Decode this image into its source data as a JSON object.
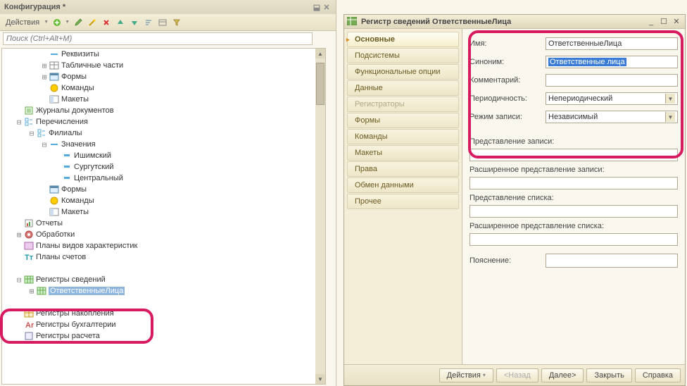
{
  "leftPanel": {
    "title": "Конфигурация *",
    "actionsLabel": "Действия",
    "searchPlaceholder": "Поиск (Ctrl+Alt+M)"
  },
  "tree": {
    "items": [
      {
        "indent": 3,
        "expand": "",
        "icon": "dash",
        "label": "Реквизиты"
      },
      {
        "indent": 3,
        "expand": "+",
        "icon": "table",
        "label": "Табличные части"
      },
      {
        "indent": 3,
        "expand": "+",
        "icon": "form",
        "label": "Формы"
      },
      {
        "indent": 3,
        "expand": "",
        "icon": "cmd",
        "label": "Команды"
      },
      {
        "indent": 3,
        "expand": "",
        "icon": "layout",
        "label": "Макеты"
      },
      {
        "indent": 1,
        "expand": "",
        "icon": "journal",
        "label": "Журналы документов"
      },
      {
        "indent": 1,
        "expand": "-",
        "icon": "enum",
        "label": "Перечисления"
      },
      {
        "indent": 2,
        "expand": "-",
        "icon": "enum",
        "label": "Филиалы"
      },
      {
        "indent": 3,
        "expand": "-",
        "icon": "dash",
        "label": "Значения"
      },
      {
        "indent": 4,
        "expand": "",
        "icon": "val",
        "label": "Ишимский"
      },
      {
        "indent": 4,
        "expand": "",
        "icon": "val",
        "label": "Сургутский"
      },
      {
        "indent": 4,
        "expand": "",
        "icon": "val",
        "label": "Центральный"
      },
      {
        "indent": 3,
        "expand": "",
        "icon": "form",
        "label": "Формы"
      },
      {
        "indent": 3,
        "expand": "",
        "icon": "cmd",
        "label": "Команды"
      },
      {
        "indent": 3,
        "expand": "",
        "icon": "layout",
        "label": "Макеты"
      },
      {
        "indent": 1,
        "expand": "",
        "icon": "report",
        "label": "Отчеты"
      },
      {
        "indent": 1,
        "expand": "+",
        "icon": "proc",
        "label": "Обработки"
      },
      {
        "indent": 1,
        "expand": "",
        "icon": "pvh",
        "label": "Планы видов характеристик"
      },
      {
        "indent": 1,
        "expand": "",
        "icon": "acct",
        "label": "Планы счетов"
      },
      {
        "indent": 1,
        "expand": "",
        "icon": "blank",
        "label": ""
      },
      {
        "indent": 1,
        "expand": "-",
        "icon": "info-reg",
        "label": "Регистры сведений"
      },
      {
        "indent": 2,
        "expand": "+",
        "icon": "info-reg",
        "label": "ОтветственныеЛица",
        "selected": true
      },
      {
        "indent": 1,
        "expand": "",
        "icon": "blank",
        "label": ""
      },
      {
        "indent": 1,
        "expand": "",
        "icon": "accum",
        "label": "Регистры накопления"
      },
      {
        "indent": 1,
        "expand": "",
        "icon": "buh",
        "label": "Регистры бухгалтерии"
      },
      {
        "indent": 1,
        "expand": "",
        "icon": "calc",
        "label": "Регистры расчета"
      }
    ]
  },
  "rightPanel": {
    "title": "Регистр сведений ОтветственныеЛица",
    "tabs": [
      {
        "label": "Основные",
        "state": "active"
      },
      {
        "label": "Подсистемы",
        "state": ""
      },
      {
        "label": "Функциональные опции",
        "state": ""
      },
      {
        "label": "Данные",
        "state": ""
      },
      {
        "label": "Регистраторы",
        "state": "disabled"
      },
      {
        "label": "Формы",
        "state": ""
      },
      {
        "label": "Команды",
        "state": ""
      },
      {
        "label": "Макеты",
        "state": ""
      },
      {
        "label": "Права",
        "state": ""
      },
      {
        "label": "Обмен данными",
        "state": ""
      },
      {
        "label": "Прочее",
        "state": ""
      }
    ],
    "form": {
      "nameLabel": "Имя:",
      "nameValue": "ОтветственныеЛица",
      "synonymLabel": "Синоним:",
      "synonymValue": "Ответственные лица",
      "commentLabel": "Комментарий:",
      "commentValue": "",
      "periodLabel": "Периодичность:",
      "periodValue": "Непериодический",
      "modeLabel": "Режим записи:",
      "modeValue": "Независимый",
      "reprRecord": "Представление записи:",
      "reprRecordExt": "Расширенное представление записи:",
      "reprList": "Представление списка:",
      "reprListExt": "Расширенное представление списка:",
      "explanation": "Пояснение:"
    },
    "footer": {
      "actions": "Действия",
      "back": "<Назад",
      "next": "Далее>",
      "close": "Закрыть",
      "help": "Справка"
    }
  }
}
